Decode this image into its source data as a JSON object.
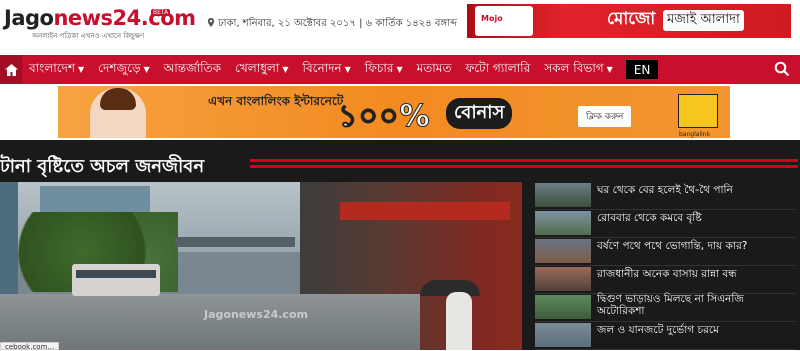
{
  "header": {
    "logo_jago": "Jago",
    "logo_news": "news24.com",
    "logo_beta": "BETA",
    "tagline": "অনলাইন পত্রিকা এখনও এখানে কিছুক্ষণ",
    "dateline": "ঢাকা, শনিবার, ২১ অক্টোবর ২০১৭ | ৬ কার্তিক ১৪২৪ বঙ্গাব্দ",
    "ad_top": {
      "brand": "মোজো",
      "slogan": "মজাই আলাদা",
      "bottle_label": "Mojo"
    }
  },
  "nav": {
    "items": [
      {
        "label": "বাংলাদেশ",
        "dropdown": true
      },
      {
        "label": "দেশজুড়ে",
        "dropdown": true
      },
      {
        "label": "আন্তর্জাতিক",
        "dropdown": false
      },
      {
        "label": "খেলাধুলা",
        "dropdown": true
      },
      {
        "label": "বিনোদন",
        "dropdown": true
      },
      {
        "label": "ফিচার",
        "dropdown": true
      },
      {
        "label": "মতামত",
        "dropdown": false
      },
      {
        "label": "ফটো গ্যালারি",
        "dropdown": false
      },
      {
        "label": "সকল বিভাগ",
        "dropdown": true
      }
    ],
    "lang": "EN"
  },
  "banner": {
    "text": "এখন বাংলালিংক ইন্টারনেটে",
    "percent": "১০০%",
    "bonus": "বোনাস",
    "cta": "ক্লিক করুন",
    "brand": "banglalink"
  },
  "lead": {
    "headline": "টানা বৃষ্টিতে অচল জনজীবন",
    "watermark": "Jagonews24.com"
  },
  "side_news": [
    "ঘর থেকে বের হলেই থৈ-থৈ পানি",
    "রোববার থেকে কমবে বৃষ্টি",
    "বর্ষণে পথে পথে ভোগান্তি, দায় কার?",
    "রাজধানীর অনেক বাসায় রান্না বন্ধ",
    "দ্বিগুণ ভাড়ায়ও মিলছে না সিএনজি অটোরিকশা",
    "জল ও যানজটে দুর্ভোগ চরমে"
  ],
  "status_bar": "cebook.com...",
  "colors": {
    "brand_red": "#c8102e",
    "dark_bg": "#1a1a1a",
    "ad_orange": "#f28a21"
  }
}
